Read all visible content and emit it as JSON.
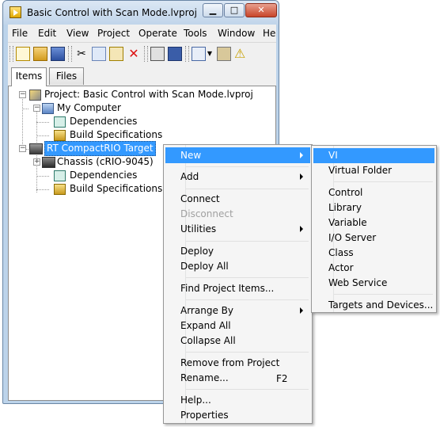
{
  "window": {
    "title": "Basic Control with Scan Mode.lvproj"
  },
  "menubar": [
    "File",
    "Edit",
    "View",
    "Project",
    "Operate",
    "Tools",
    "Window",
    "He"
  ],
  "tabs": [
    "Items",
    "Files"
  ],
  "tree": {
    "project": "Project: Basic Control with Scan Mode.lvproj",
    "my_computer": "My Computer",
    "mc_dependencies": "Dependencies",
    "mc_build": "Build Specifications",
    "target": "RT CompactRIO Target",
    "chassis": "Chassis (cRIO-9045)",
    "t_dependencies": "Dependencies",
    "t_build": "Build Specifications"
  },
  "context_menu": {
    "new": "New",
    "add": "Add",
    "connect": "Connect",
    "disconnect": "Disconnect",
    "utilities": "Utilities",
    "deploy": "Deploy",
    "deploy_all": "Deploy All",
    "find": "Find Project Items...",
    "arrange": "Arrange By",
    "expand_all": "Expand All",
    "collapse_all": "Collapse All",
    "remove": "Remove from Project",
    "rename": "Rename...",
    "rename_shortcut": "F2",
    "help": "Help...",
    "properties": "Properties"
  },
  "submenu": {
    "vi": "VI",
    "virtual_folder": "Virtual Folder",
    "control": "Control",
    "library": "Library",
    "variable": "Variable",
    "io_server": "I/O Server",
    "class": "Class",
    "actor": "Actor",
    "web_service": "Web Service",
    "targets": "Targets and Devices..."
  },
  "colors": {
    "highlight": "#3399ff",
    "title_bg": "#c1d5ea",
    "menu_bg": "#f5f5f5"
  }
}
